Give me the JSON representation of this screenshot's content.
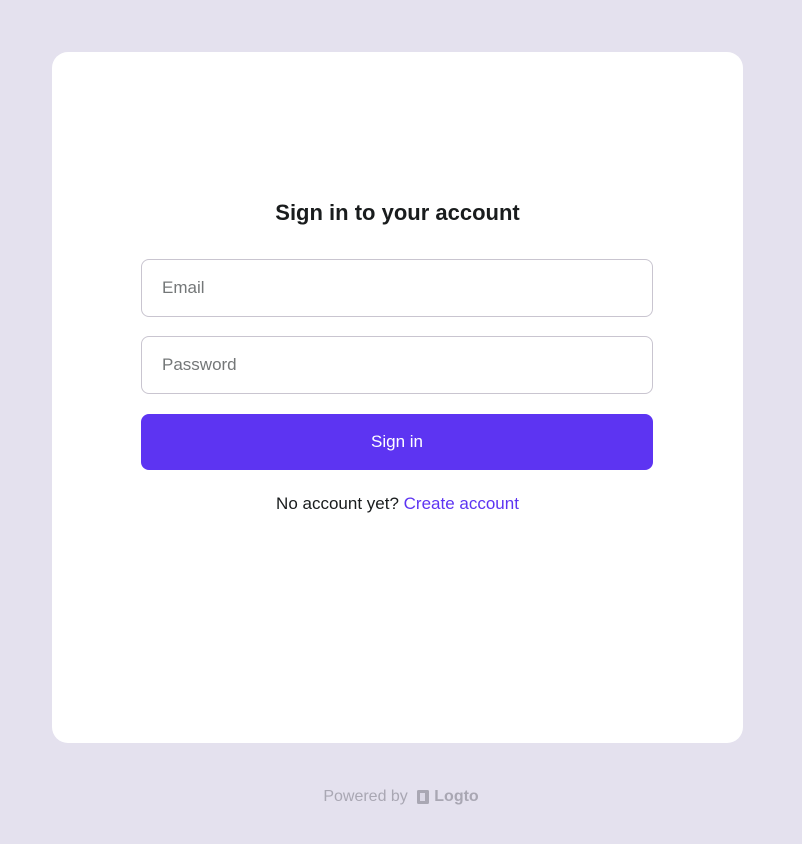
{
  "signin": {
    "title": "Sign in to your account",
    "email_placeholder": "Email",
    "password_placeholder": "Password",
    "submit_label": "Sign in",
    "no_account_text": "No account yet?",
    "create_account_label": "Create account"
  },
  "footer": {
    "powered_by": "Powered by",
    "brand_name": "Logto",
    "brand_icon": "logto-logo-icon"
  },
  "colors": {
    "background": "#e4e1ee",
    "card": "#ffffff",
    "accent": "#5d34f2",
    "text": "#191c1d",
    "muted": "#a9a7b3"
  }
}
